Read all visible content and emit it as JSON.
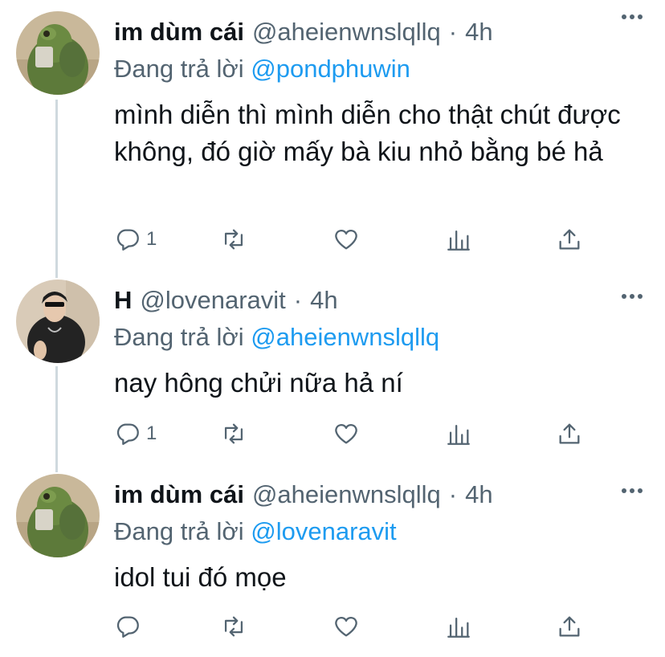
{
  "tweets": [
    {
      "name": "im dùm cái",
      "handle": "@aheienwnslqllq",
      "separator": "·",
      "time": "4h",
      "replying_prefix": "Đang trả lời",
      "replying_to": "@pondphuwin",
      "text": "mình diễn thì mình diễn cho thật chút được không, đó giờ mấy bà kiu nhỏ bằng bé hả",
      "reply_count": "1",
      "avatar": "green-frog-avatar"
    },
    {
      "name": "H",
      "handle": "@lovenaravit",
      "separator": "·",
      "time": "4h",
      "replying_prefix": "Đang trả lời",
      "replying_to": "@aheienwnslqllq",
      "text": "nay hông chửi nữa hả ní",
      "reply_count": "1",
      "avatar": "person-photo-avatar"
    },
    {
      "name": "im dùm cái",
      "handle": "@aheienwnslqllq",
      "separator": "·",
      "time": "4h",
      "replying_prefix": "Đang trả lời",
      "replying_to": "@lovenaravit",
      "text": "idol tui đó mọe",
      "reply_count": "",
      "avatar": "green-frog-avatar"
    }
  ],
  "icons": {
    "reply": "reply-icon",
    "retweet": "retweet-icon",
    "like": "like-icon",
    "analytics": "analytics-icon",
    "share": "share-icon",
    "more": "more-icon"
  },
  "colors": {
    "text": "#0f1419",
    "secondary": "#536471",
    "link": "#1d9bf0",
    "thread_line": "#cfd9de"
  }
}
